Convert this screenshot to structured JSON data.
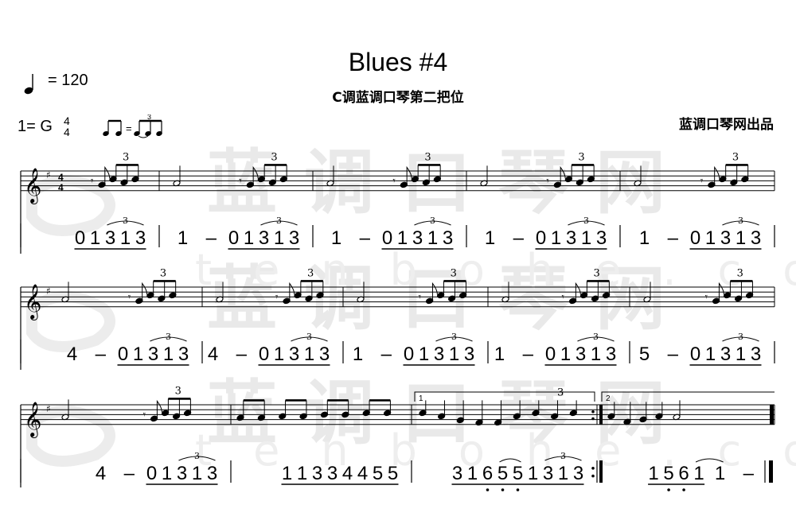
{
  "title": "Blues #4",
  "subtitle": "C调蓝调口琴第二把位",
  "publisher": "蓝调口琴网出品",
  "tempo": {
    "note": "quarter-note-icon",
    "text": "= 120"
  },
  "key": "1= G",
  "time_signature": {
    "top": "4",
    "bottom": "4"
  },
  "swing_icon": "swing-eighths-icon",
  "triplet_label": "3",
  "volta_labels": [
    "1",
    "2"
  ],
  "watermark": {
    "text": "蓝调口琴网",
    "url_text": "tenbohe.com"
  },
  "systems": [
    {
      "measures": [
        {
          "tokens": [
            {
              "t": "0",
              "u": 1
            },
            {
              "t": "1",
              "u": 1
            },
            {
              "t": "3",
              "u": 1,
              "trip": "s"
            },
            {
              "t": "1",
              "u": 1,
              "trip": "m"
            },
            {
              "t": "3",
              "u": 1,
              "trip": "e"
            }
          ]
        },
        {
          "tokens": [
            {
              "t": "1"
            },
            {
              "t": "–"
            },
            {
              "t": "0",
              "u": 1
            },
            {
              "t": "1",
              "u": 1
            },
            {
              "t": "3",
              "u": 1,
              "trip": "s"
            },
            {
              "t": "1",
              "u": 1,
              "trip": "m"
            },
            {
              "t": "3",
              "u": 1,
              "trip": "e"
            }
          ]
        },
        {
          "tokens": [
            {
              "t": "1"
            },
            {
              "t": "–"
            },
            {
              "t": "0",
              "u": 1
            },
            {
              "t": "1",
              "u": 1
            },
            {
              "t": "3",
              "u": 1,
              "trip": "s"
            },
            {
              "t": "1",
              "u": 1,
              "trip": "m"
            },
            {
              "t": "3",
              "u": 1,
              "trip": "e"
            }
          ]
        },
        {
          "tokens": [
            {
              "t": "1"
            },
            {
              "t": "–"
            },
            {
              "t": "0",
              "u": 1
            },
            {
              "t": "1",
              "u": 1
            },
            {
              "t": "3",
              "u": 1,
              "trip": "s"
            },
            {
              "t": "1",
              "u": 1,
              "trip": "m"
            },
            {
              "t": "3",
              "u": 1,
              "trip": "e"
            }
          ]
        },
        {
          "tokens": [
            {
              "t": "1"
            },
            {
              "t": "–"
            },
            {
              "t": "0",
              "u": 1
            },
            {
              "t": "1",
              "u": 1
            },
            {
              "t": "3",
              "u": 1,
              "trip": "s"
            },
            {
              "t": "1",
              "u": 1,
              "trip": "m"
            },
            {
              "t": "3",
              "u": 1,
              "trip": "e"
            }
          ]
        }
      ]
    },
    {
      "measures": [
        {
          "tokens": [
            {
              "t": "4"
            },
            {
              "t": "–"
            },
            {
              "t": "0",
              "u": 1
            },
            {
              "t": "1",
              "u": 1
            },
            {
              "t": "3",
              "u": 1,
              "trip": "s"
            },
            {
              "t": "1",
              "u": 1,
              "trip": "m"
            },
            {
              "t": "3",
              "u": 1,
              "trip": "e"
            }
          ]
        },
        {
          "tokens": [
            {
              "t": "4"
            },
            {
              "t": "–"
            },
            {
              "t": "0",
              "u": 1
            },
            {
              "t": "1",
              "u": 1
            },
            {
              "t": "3",
              "u": 1,
              "trip": "s"
            },
            {
              "t": "1",
              "u": 1,
              "trip": "m"
            },
            {
              "t": "3",
              "u": 1,
              "trip": "e"
            }
          ]
        },
        {
          "tokens": [
            {
              "t": "1"
            },
            {
              "t": "–"
            },
            {
              "t": "0",
              "u": 1
            },
            {
              "t": "1",
              "u": 1
            },
            {
              "t": "3",
              "u": 1,
              "trip": "s"
            },
            {
              "t": "1",
              "u": 1,
              "trip": "m"
            },
            {
              "t": "3",
              "u": 1,
              "trip": "e"
            }
          ]
        },
        {
          "tokens": [
            {
              "t": "1"
            },
            {
              "t": "–"
            },
            {
              "t": "0",
              "u": 1
            },
            {
              "t": "1",
              "u": 1
            },
            {
              "t": "3",
              "u": 1,
              "trip": "s"
            },
            {
              "t": "1",
              "u": 1,
              "trip": "m"
            },
            {
              "t": "3",
              "u": 1,
              "trip": "e"
            }
          ]
        },
        {
          "tokens": [
            {
              "t": "5"
            },
            {
              "t": "–"
            },
            {
              "t": "0",
              "u": 1
            },
            {
              "t": "1",
              "u": 1
            },
            {
              "t": "3",
              "u": 1,
              "trip": "s"
            },
            {
              "t": "1",
              "u": 1,
              "trip": "m"
            },
            {
              "t": "3",
              "u": 1,
              "trip": "e"
            }
          ]
        }
      ]
    },
    {
      "measures": [
        {
          "tokens": [
            {
              "t": "4"
            },
            {
              "t": "–"
            },
            {
              "t": "0",
              "u": 1
            },
            {
              "t": "1",
              "u": 1
            },
            {
              "t": "3",
              "u": 1,
              "trip": "s"
            },
            {
              "t": "1",
              "u": 1,
              "trip": "m"
            },
            {
              "t": "3",
              "u": 1,
              "trip": "e"
            }
          ]
        },
        {
          "tokens": [
            {
              "t": "1",
              "u": 1
            },
            {
              "t": "1",
              "u": 1
            },
            {
              "t": "3",
              "u": 1
            },
            {
              "t": "3",
              "u": 1
            },
            {
              "t": "4",
              "u": 1
            },
            {
              "t": "4",
              "u": 1
            },
            {
              "t": "5",
              "u": 1
            },
            {
              "t": "5",
              "u": 1
            }
          ]
        },
        {
          "tokens": [
            {
              "t": "3",
              "u": 1
            },
            {
              "t": "1",
              "u": 1
            },
            {
              "t": "6",
              "u": 1,
              "dot": 1
            },
            {
              "t": "5",
              "u": 1,
              "dot": 1,
              "tie": 1
            },
            {
              "t": "5",
              "u": 1,
              "dot": 1
            },
            {
              "t": "1",
              "u": 1
            },
            {
              "t": "3",
              "u": 1,
              "trip": "s"
            },
            {
              "t": "1",
              "u": 1,
              "trip": "m"
            },
            {
              "t": "3",
              "u": 1,
              "trip": "e"
            }
          ]
        },
        {
          "tokens": [
            {
              "t": "1",
              "u": 1
            },
            {
              "t": "5",
              "u": 1,
              "dot": 1
            },
            {
              "t": "6",
              "u": 1,
              "dot": 1
            },
            {
              "t": "1",
              "u": 1,
              "tie": 1
            },
            {
              "t": "1"
            },
            {
              "t": "–"
            }
          ]
        }
      ]
    }
  ]
}
